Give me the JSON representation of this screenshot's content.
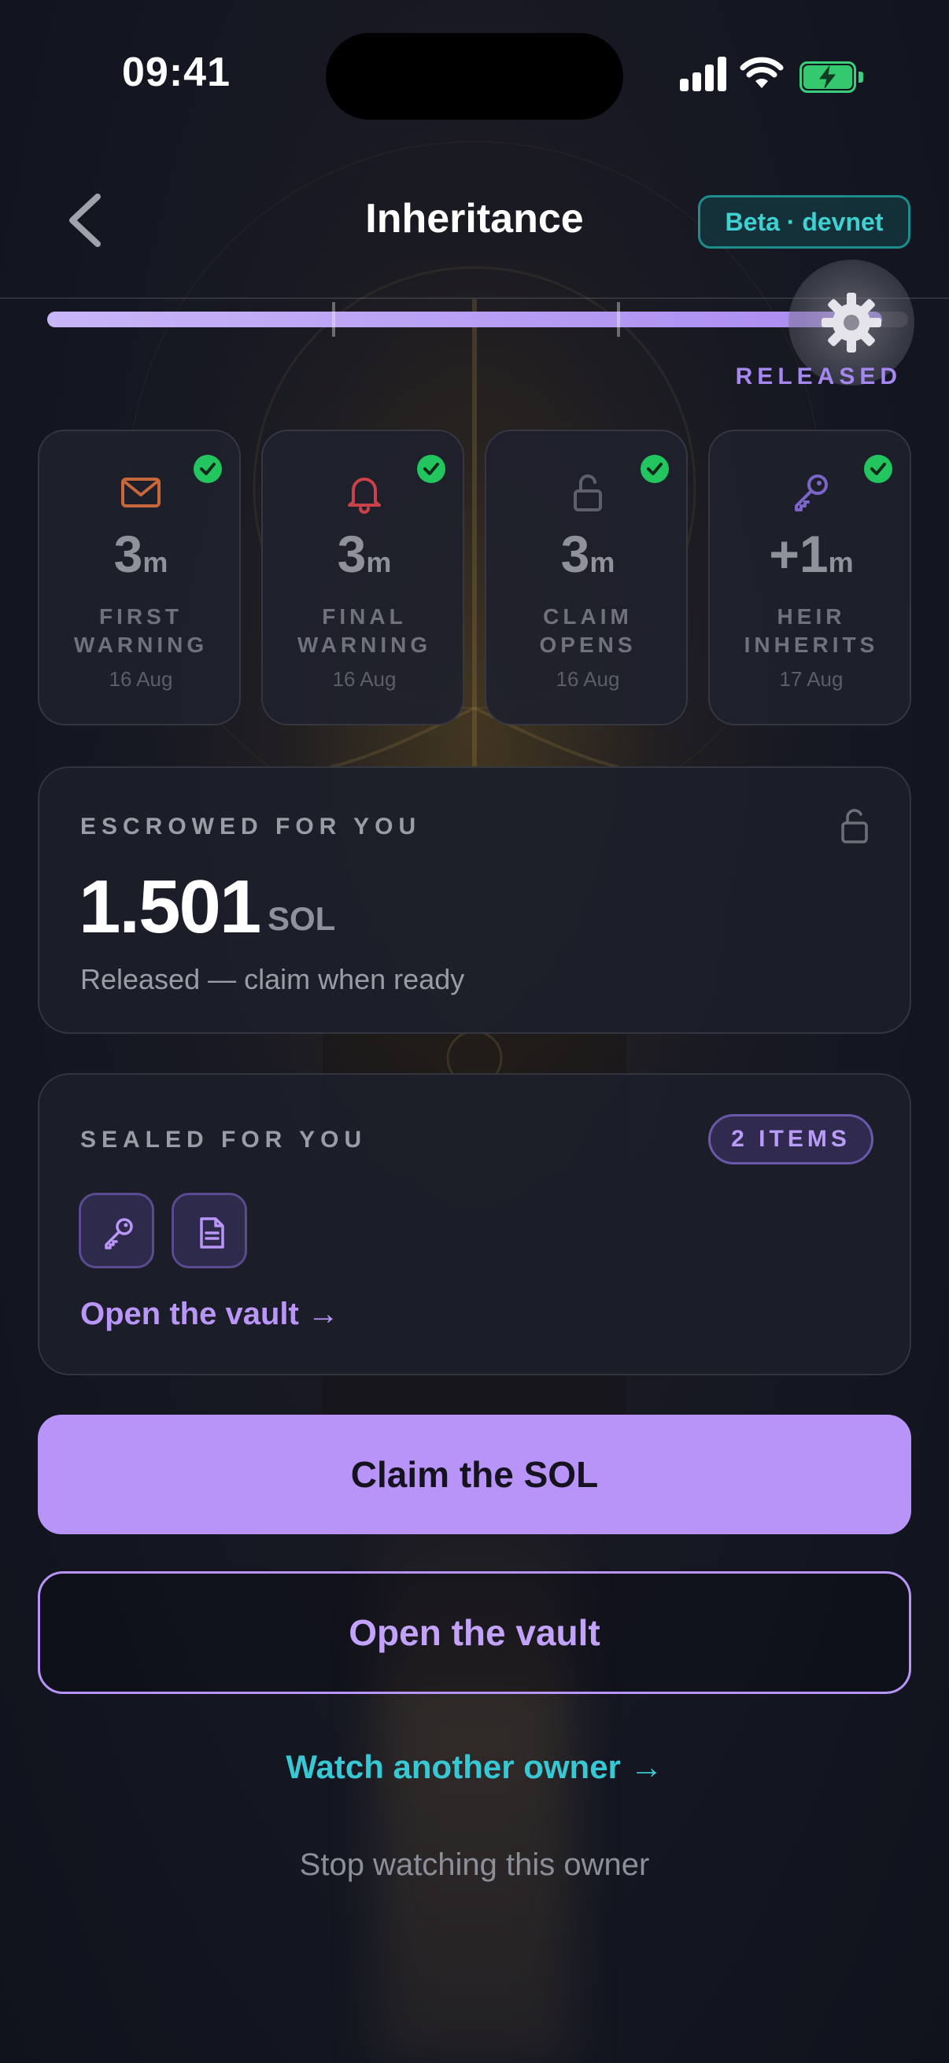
{
  "status_bar": {
    "time": "09:41"
  },
  "header": {
    "title": "Inheritance",
    "badge": "Beta · devnet",
    "back_icon": "chevron-left-icon"
  },
  "progress": {
    "fraction": 0.97,
    "state_label": "RELEASED",
    "knob_icon": "gear-icon"
  },
  "timeline": [
    {
      "icon": "mail-icon",
      "value": "3",
      "unit": "m",
      "label_line1": "FIRST",
      "label_line2": "WARNING",
      "date": "16 Aug",
      "done": true,
      "icon_color": "#c8683a"
    },
    {
      "icon": "bell-icon",
      "value": "3",
      "unit": "m",
      "label_line1": "FINAL",
      "label_line2": "WARNING",
      "date": "16 Aug",
      "done": true,
      "icon_color": "#c9424a"
    },
    {
      "icon": "unlock-icon",
      "value": "3",
      "unit": "m",
      "label_line1": "CLAIM",
      "label_line2": "OPENS",
      "date": "16 Aug",
      "done": true,
      "icon_color": "#5d606a"
    },
    {
      "icon": "key-icon",
      "value": "+1",
      "unit": "m",
      "label_line1": "HEIR",
      "label_line2": "INHERITS",
      "date": "17 Aug",
      "done": true,
      "icon_color": "#7b66c8"
    }
  ],
  "escrow": {
    "label": "ESCROWED FOR YOU",
    "amount": "1.501",
    "unit": "SOL",
    "status": "Released — claim when ready",
    "icon": "unlock-icon"
  },
  "sealed": {
    "label": "SEALED FOR YOU",
    "count_badge": "2 ITEMS",
    "items": [
      {
        "icon": "key-icon"
      },
      {
        "icon": "document-icon"
      }
    ],
    "link": "Open the vault →"
  },
  "actions": {
    "primary": "Claim the SOL",
    "secondary": "Open the vault",
    "watch_link": "Watch another owner →",
    "stop_link": "Stop watching this owner"
  },
  "colors": {
    "accent": "#b894f9",
    "teal": "#37c8d3",
    "success": "#22c55e"
  }
}
